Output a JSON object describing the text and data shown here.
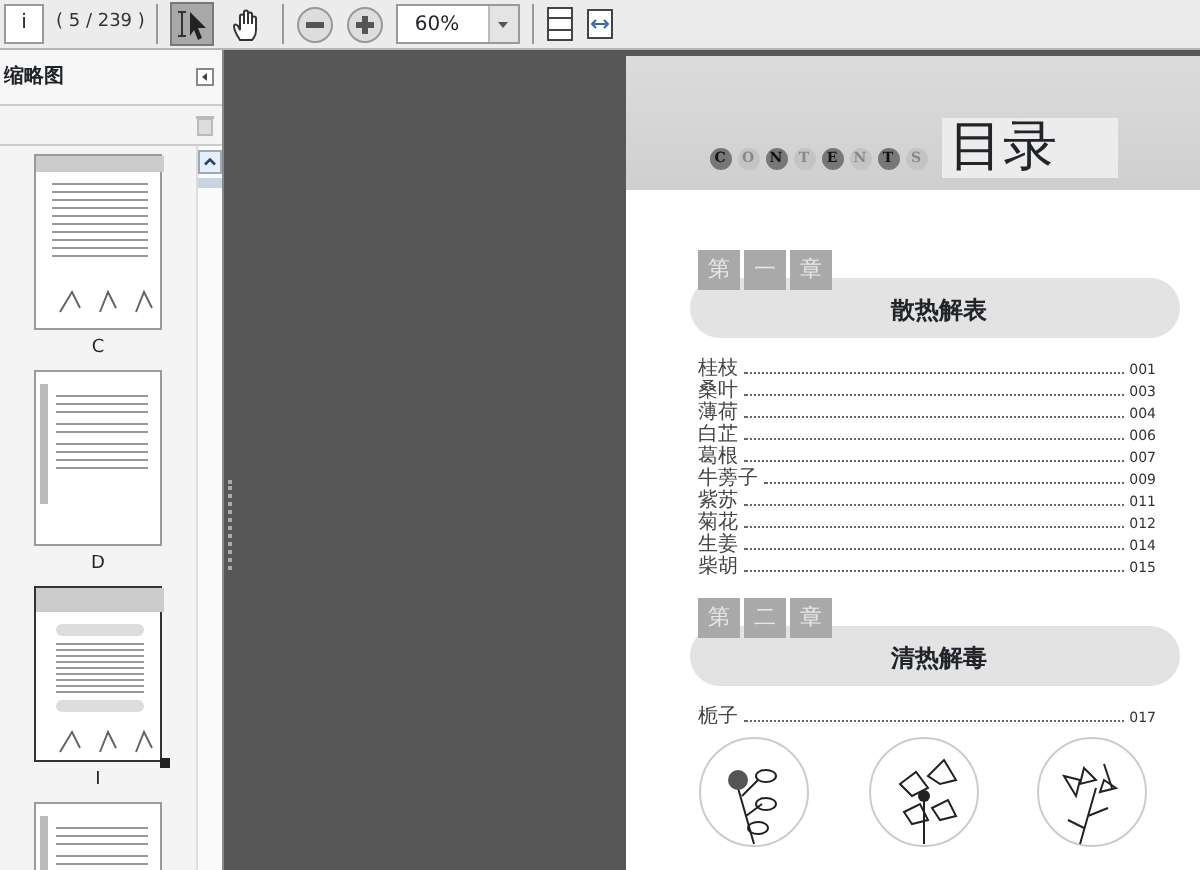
{
  "toolbar": {
    "page_field": "i",
    "page_count": "( 5 / 239 )",
    "tools": [
      {
        "kind": "select",
        "selected": true
      },
      {
        "kind": "hand",
        "selected": false
      }
    ],
    "zoom_value": "60%"
  },
  "sidebar": {
    "title": "缩略图",
    "thumbnails": [
      {
        "kind": "text",
        "label": "C",
        "selected": false
      },
      {
        "kind": "side",
        "label": "D",
        "selected": false
      },
      {
        "kind": "toc",
        "label": "I",
        "selected": true
      },
      {
        "kind": "side",
        "selected": false
      }
    ]
  },
  "page": {
    "header_letters": [
      "C",
      "O",
      "N",
      "T",
      "E",
      "N",
      "T",
      "S"
    ],
    "header_title": "目录",
    "chapters": [
      {
        "tag": [
          "第",
          "一",
          "章"
        ],
        "title": "散热解表",
        "entries": [
          {
            "name": "桂枝",
            "page": "001"
          },
          {
            "name": "桑叶",
            "page": "003"
          },
          {
            "name": "薄荷",
            "page": "004"
          },
          {
            "name": "白芷",
            "page": "006"
          },
          {
            "name": "葛根",
            "page": "007"
          },
          {
            "name": "牛蒡子",
            "page": "009"
          },
          {
            "name": "紫苏",
            "page": "011"
          },
          {
            "name": "菊花",
            "page": "012"
          },
          {
            "name": "生姜",
            "page": "014"
          },
          {
            "name": "柴胡",
            "page": "015"
          }
        ]
      },
      {
        "tag": [
          "第",
          "二",
          "章"
        ],
        "title": "清热解毒",
        "entries": [
          {
            "name": "栀子",
            "page": "017"
          }
        ]
      }
    ]
  }
}
